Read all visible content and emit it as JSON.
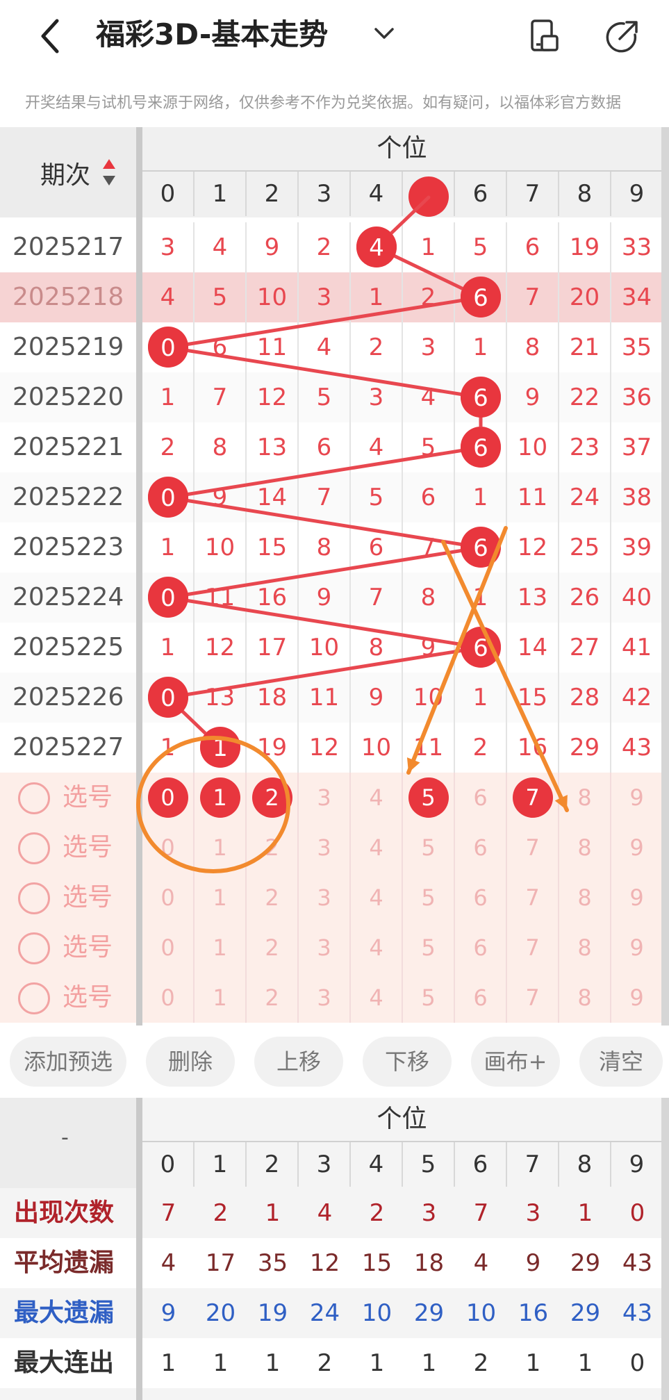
{
  "header": {
    "title": "福彩3D-基本走势",
    "notice": "开奖结果与试机号来源于网络，仅供参考不作为兑奖依据。如有疑问，以福体彩官方数据"
  },
  "trend": {
    "period_label": "期次",
    "group_label": "个位",
    "digits": [
      "0",
      "1",
      "2",
      "3",
      "4",
      "5",
      "6",
      "7",
      "8",
      "9"
    ],
    "rows": [
      {
        "period": "2025217",
        "cells": [
          "3",
          "4",
          "9",
          "2",
          "4",
          "1",
          "5",
          "6",
          "19",
          "33"
        ],
        "hit": 4
      },
      {
        "period": "2025218",
        "cells": [
          "4",
          "5",
          "10",
          "3",
          "1",
          "2",
          "6",
          "7",
          "20",
          "34"
        ],
        "hit": 6
      },
      {
        "period": "2025219",
        "cells": [
          "0",
          "6",
          "11",
          "4",
          "2",
          "3",
          "1",
          "8",
          "21",
          "35"
        ],
        "hit": 0
      },
      {
        "period": "2025220",
        "cells": [
          "1",
          "7",
          "12",
          "5",
          "3",
          "4",
          "6",
          "9",
          "22",
          "36"
        ],
        "hit": 6
      },
      {
        "period": "2025221",
        "cells": [
          "2",
          "8",
          "13",
          "6",
          "4",
          "5",
          "6",
          "10",
          "23",
          "37"
        ],
        "hit": 6
      },
      {
        "period": "2025222",
        "cells": [
          "0",
          "9",
          "14",
          "7",
          "5",
          "6",
          "1",
          "11",
          "24",
          "38"
        ],
        "hit": 0
      },
      {
        "period": "2025223",
        "cells": [
          "1",
          "10",
          "15",
          "8",
          "6",
          "7",
          "6",
          "12",
          "25",
          "39"
        ],
        "hit": 6
      },
      {
        "period": "2025224",
        "cells": [
          "0",
          "11",
          "16",
          "9",
          "7",
          "8",
          "1",
          "13",
          "26",
          "40"
        ],
        "hit": 0
      },
      {
        "period": "2025225",
        "cells": [
          "1",
          "12",
          "17",
          "10",
          "8",
          "9",
          "6",
          "14",
          "27",
          "41"
        ],
        "hit": 6
      },
      {
        "period": "2025226",
        "cells": [
          "0",
          "13",
          "18",
          "11",
          "9",
          "10",
          "1",
          "15",
          "28",
          "42"
        ],
        "hit": 0
      },
      {
        "period": "2025227",
        "cells": [
          "1",
          "1",
          "19",
          "12",
          "10",
          "11",
          "2",
          "16",
          "29",
          "43"
        ],
        "hit": 1
      }
    ],
    "pick_label": "选号",
    "pick_rows": [
      {
        "cells": [
          "0",
          "1",
          "2",
          "3",
          "4",
          "5",
          "6",
          "7",
          "8",
          "9"
        ],
        "selected": [
          0,
          1,
          2,
          5,
          7
        ]
      },
      {
        "cells": [
          "0",
          "1",
          "2",
          "3",
          "4",
          "5",
          "6",
          "7",
          "8",
          "9"
        ],
        "selected": []
      },
      {
        "cells": [
          "0",
          "1",
          "2",
          "3",
          "4",
          "5",
          "6",
          "7",
          "8",
          "9"
        ],
        "selected": []
      },
      {
        "cells": [
          "0",
          "1",
          "2",
          "3",
          "4",
          "5",
          "6",
          "7",
          "8",
          "9"
        ],
        "selected": []
      },
      {
        "cells": [
          "0",
          "1",
          "2",
          "3",
          "4",
          "5",
          "6",
          "7",
          "8",
          "9"
        ],
        "selected": []
      }
    ]
  },
  "buttons": [
    "添加预选",
    "删除",
    "上移",
    "下移",
    "画布+",
    "清空"
  ],
  "stats": {
    "corner": "-",
    "group_label": "个位",
    "digits": [
      "0",
      "1",
      "2",
      "3",
      "4",
      "5",
      "6",
      "7",
      "8",
      "9"
    ],
    "rows": [
      {
        "label": "出现次数",
        "color": "#b0222a",
        "values": [
          "7",
          "2",
          "1",
          "4",
          "2",
          "3",
          "7",
          "3",
          "1",
          "0"
        ]
      },
      {
        "label": "平均遗漏",
        "color": "#7a2a2a",
        "values": [
          "4",
          "17",
          "35",
          "12",
          "15",
          "18",
          "4",
          "9",
          "29",
          "43"
        ]
      },
      {
        "label": "最大遗漏",
        "color": "#2f5fc4",
        "values": [
          "9",
          "20",
          "19",
          "24",
          "10",
          "29",
          "10",
          "16",
          "29",
          "43"
        ]
      },
      {
        "label": "最大连出",
        "color": "#333333",
        "values": [
          "1",
          "1",
          "1",
          "2",
          "1",
          "1",
          "2",
          "1",
          "1",
          "0"
        ]
      }
    ]
  },
  "colors": {
    "ball": "#e8363e",
    "line": "#e8474f",
    "annotation": "#f28a2e",
    "highlight_row": "#f6d3d3"
  },
  "icons": [
    "back-chevron-icon",
    "dropdown-chevron-icon",
    "device-icon",
    "share-icon",
    "sort-arrows-icon"
  ]
}
